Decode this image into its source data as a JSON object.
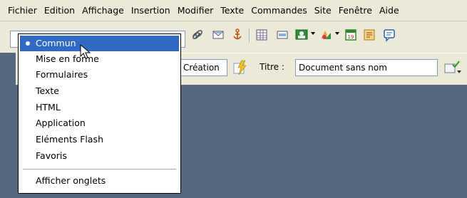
{
  "menu": {
    "items": [
      "Fichier",
      "Edition",
      "Affichage",
      "Insertion",
      "Modifier",
      "Texte",
      "Commandes",
      "Site",
      "Fenêtre",
      "Aide"
    ]
  },
  "insert_bar": {
    "selected_category": "Commun",
    "categories": [
      {
        "label": "Commun",
        "selected": true
      },
      {
        "label": "Mise en forme",
        "selected": false
      },
      {
        "label": "Formulaires",
        "selected": false
      },
      {
        "label": "Texte",
        "selected": false
      },
      {
        "label": "HTML",
        "selected": false
      },
      {
        "label": "Application",
        "selected": false
      },
      {
        "label": "Eléments Flash",
        "selected": false
      },
      {
        "label": "Favoris",
        "selected": false
      }
    ],
    "show_tabs_label": "Afficher onglets",
    "icons": [
      "hyperlink-icon",
      "email-link-icon",
      "named-anchor-icon",
      "table-icon",
      "layer-icon",
      "image-icon",
      "media-icon",
      "date-icon",
      "comment-icon",
      "template-icon"
    ]
  },
  "document_toolbar": {
    "design_view_label": "Création",
    "title_label": "Titre :",
    "title_value": "Document sans nom"
  },
  "colors": {
    "selection": "#316ac5",
    "workspace": "#56687e",
    "chrome": "#ece9d8"
  }
}
